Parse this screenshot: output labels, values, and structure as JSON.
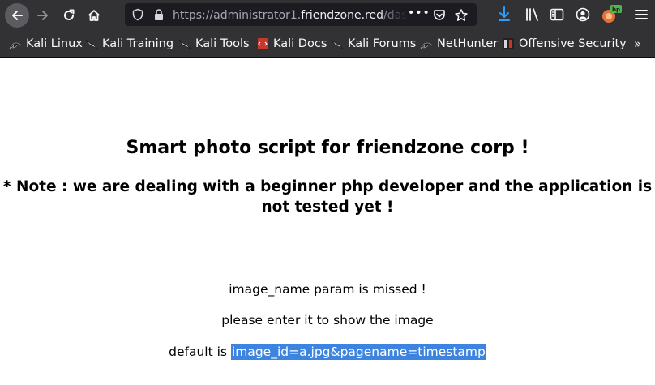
{
  "browser": {
    "url_prefix": "https://administrator1.",
    "url_host": "friendzone.red",
    "url_suffix": "/das",
    "more_label": "•••"
  },
  "bookmarks": [
    {
      "label": "Kali Linux",
      "icon": "kali-dragon-icon"
    },
    {
      "label": "Kali Training",
      "icon": "kali-dragon-icon"
    },
    {
      "label": "Kali Tools",
      "icon": "kali-dragon-icon"
    },
    {
      "label": "Kali Docs",
      "icon": "kali-docs-icon"
    },
    {
      "label": "Kali Forums",
      "icon": "kali-dragon-icon"
    },
    {
      "label": "NetHunter",
      "icon": "kali-dragon-icon"
    },
    {
      "label": "Offensive Security",
      "icon": "offsec-icon"
    }
  ],
  "bookmarks_overflow": "»",
  "page": {
    "title": "Smart photo script for friendzone corp !",
    "note": "* Note : we are dealing with a beginner php developer and the application is not tested yet !",
    "line1": "image_name param is missed !",
    "line2": "please enter it to show the image",
    "line3_prefix": "default is ",
    "line3_selected": "image_id=a.jpg&pagename=timestamp"
  },
  "colors": {
    "toolbar_bg": "#323234",
    "urlbar_bg": "#1c1b22",
    "selection": "#3c84e0",
    "download_blue": "#2a9dff",
    "burp_orange": "#e8703a",
    "burp_badge_green": "#52b44a"
  }
}
